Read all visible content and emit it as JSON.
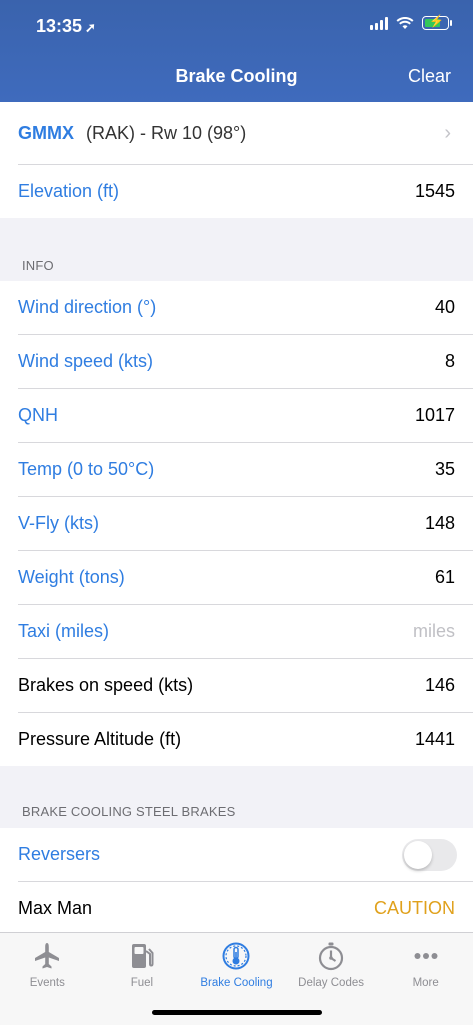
{
  "status": {
    "time": "13:35",
    "location_icon": "location-arrow-icon"
  },
  "nav": {
    "title": "Brake Cooling",
    "clear": "Clear"
  },
  "airport": {
    "code": "GMMX",
    "detail": "(RAK) - Rw 10  (98°)"
  },
  "elevation": {
    "label": "Elevation (ft)",
    "value": "1545"
  },
  "info": {
    "header": "INFO",
    "rows": [
      {
        "label": "Wind direction (°)",
        "value": "40"
      },
      {
        "label": "Wind speed (kts)",
        "value": "8"
      },
      {
        "label": "QNH",
        "value": "1017"
      },
      {
        "label": "Temp (0 to 50°C)",
        "value": "35"
      },
      {
        "label": "V-Fly (kts)",
        "value": "148"
      },
      {
        "label": "Weight (tons)",
        "value": "61"
      },
      {
        "label": "Taxi (miles)",
        "placeholder": "miles"
      },
      {
        "label": "Brakes on speed (kts)",
        "value": "146"
      },
      {
        "label": "Pressure Altitude (ft)",
        "value": "1441"
      }
    ]
  },
  "brake_section": {
    "header": "BRAKE COOLING STEEL BRAKES",
    "reversers_label": "Reversers",
    "reversers_on": false,
    "maxman_label": "Max Man",
    "maxman_value": "CAUTION"
  },
  "tabs": [
    {
      "label": "Events",
      "icon": "airplane-icon"
    },
    {
      "label": "Fuel",
      "icon": "fuel-pump-icon"
    },
    {
      "label": "Brake Cooling",
      "icon": "thermometer-icon",
      "active": true
    },
    {
      "label": "Delay Codes",
      "icon": "stopwatch-icon"
    },
    {
      "label": "More",
      "icon": "more-icon"
    }
  ],
  "colors": {
    "accent": "#2f7de1",
    "header": "#3f6bbd",
    "caution": "#e0a11c"
  }
}
